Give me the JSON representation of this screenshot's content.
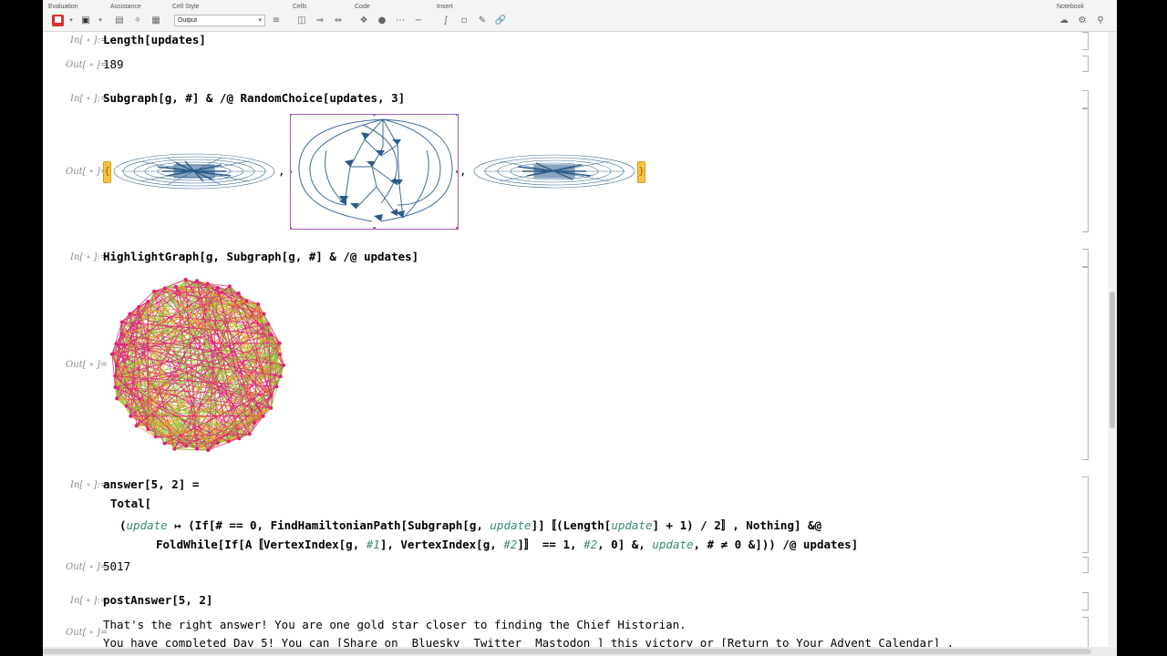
{
  "toolbar": {
    "groups": {
      "evaluation": "Evaluation",
      "assistance": "Assistance",
      "cell_style": "Cell Style",
      "cells": "Cells",
      "code": "Code",
      "insert": "Insert",
      "notebook": "Notebook"
    },
    "cell_style_value": "Output"
  },
  "labels": {
    "in": "In[ ∘ ]:=",
    "out": "Out[ ∘ ]="
  },
  "cells": {
    "c1_code": "Length[updates]",
    "c1_out": "189",
    "c2_code": "Subgraph[g, #] & /@ RandomChoice[updates, 3]",
    "c3_code": "HighlightGraph[g, Subgraph[g, #] & /@ updates]",
    "c4_line1": "answer[5, 2] =",
    "c4_line2": "Total[",
    "c4_line3_a": "(",
    "c4_line3_b": "update",
    "c4_line3_c": " ↦ (If[# == 0, FindHamiltonianPath[Subgraph[g, ",
    "c4_line3_d": "update",
    "c4_line3_e": "]]〚(Length[",
    "c4_line3_f": "update",
    "c4_line3_g": "] + 1) / 2〛, Nothing] &@",
    "c4_line4_a": "FoldWhile[If[A〚VertexIndex[g, ",
    "c4_line4_b": "#1",
    "c4_line4_c": "], VertexIndex[g, ",
    "c4_line4_d": "#2",
    "c4_line4_e": "]〛 == 1, ",
    "c4_line4_f": "#2",
    "c4_line4_g": ", 0] &, ",
    "c4_line4_h": "update",
    "c4_line4_i": ", # ≠ 0 &])) /@ updates]",
    "c4_out": "5017",
    "c5_code": "postAnswer[5, 2]",
    "c5_out1": "That's the right answer! You are one gold star closer to finding the Chief Historian.",
    "c5_out2": "You have completed Day 5! You can [Share on  Bluesky  Twitter  Mastodon ] this victory or [Return to Your Advent Calendar] ."
  },
  "colors": {
    "graph_edge": "#3d6b9a",
    "highlight_pink": "#e0207a",
    "highlight_green": "#8ccf3a",
    "highlight_orange": "#f0a020",
    "selection_frame": "#a060b0",
    "label_gray": "#8a8a8a",
    "slot_green": "#3a8a6a"
  }
}
